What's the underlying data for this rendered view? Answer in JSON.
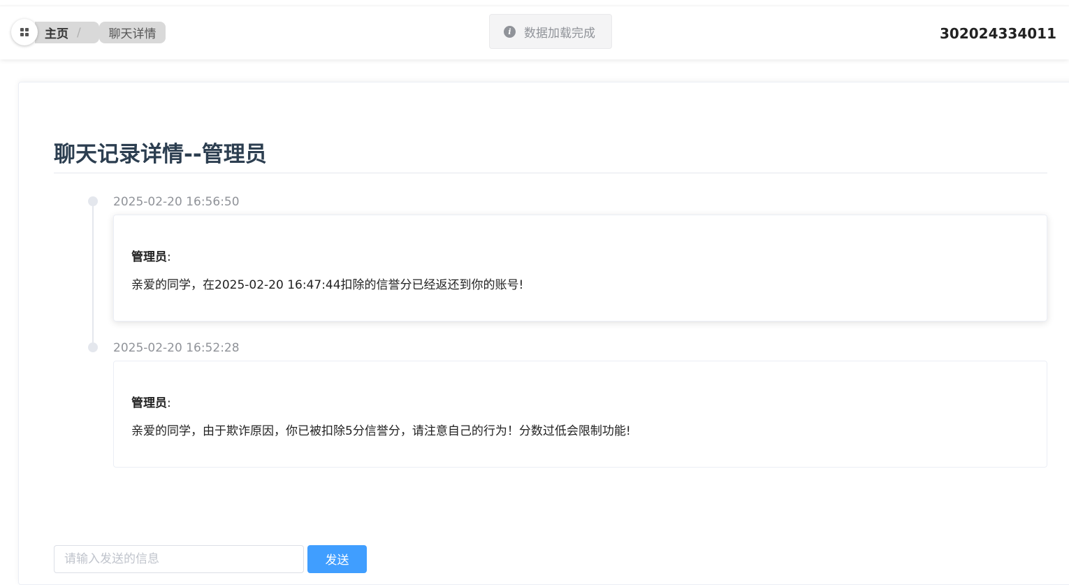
{
  "header": {
    "breadcrumb": [
      {
        "label": "主页",
        "separator": "/"
      },
      {
        "label": "聊天详情"
      }
    ],
    "toast": {
      "icon": "info-icon",
      "message": "数据加载完成"
    },
    "user_id": "302024334011"
  },
  "main": {
    "title": "聊天记录详情--管理员",
    "messages": [
      {
        "time": "2025-02-20 16:56:50",
        "sender": "管理员",
        "sender_suffix": ":",
        "text": "亲爱的同学，在2025-02-20 16:47:44扣除的信誉分已经返还到你的账号!"
      },
      {
        "time": "2025-02-20 16:52:28",
        "sender": "管理员",
        "sender_suffix": ":",
        "text": "亲爱的同学，由于欺诈原因，你已被扣除5分信誉分，请注意自己的行为！分数过低会限制功能!"
      }
    ]
  },
  "composer": {
    "placeholder": "请输入发送的信息",
    "send_label": "发送"
  },
  "colors": {
    "accent": "#409eff",
    "title": "#2c3e50",
    "muted": "#909399"
  }
}
